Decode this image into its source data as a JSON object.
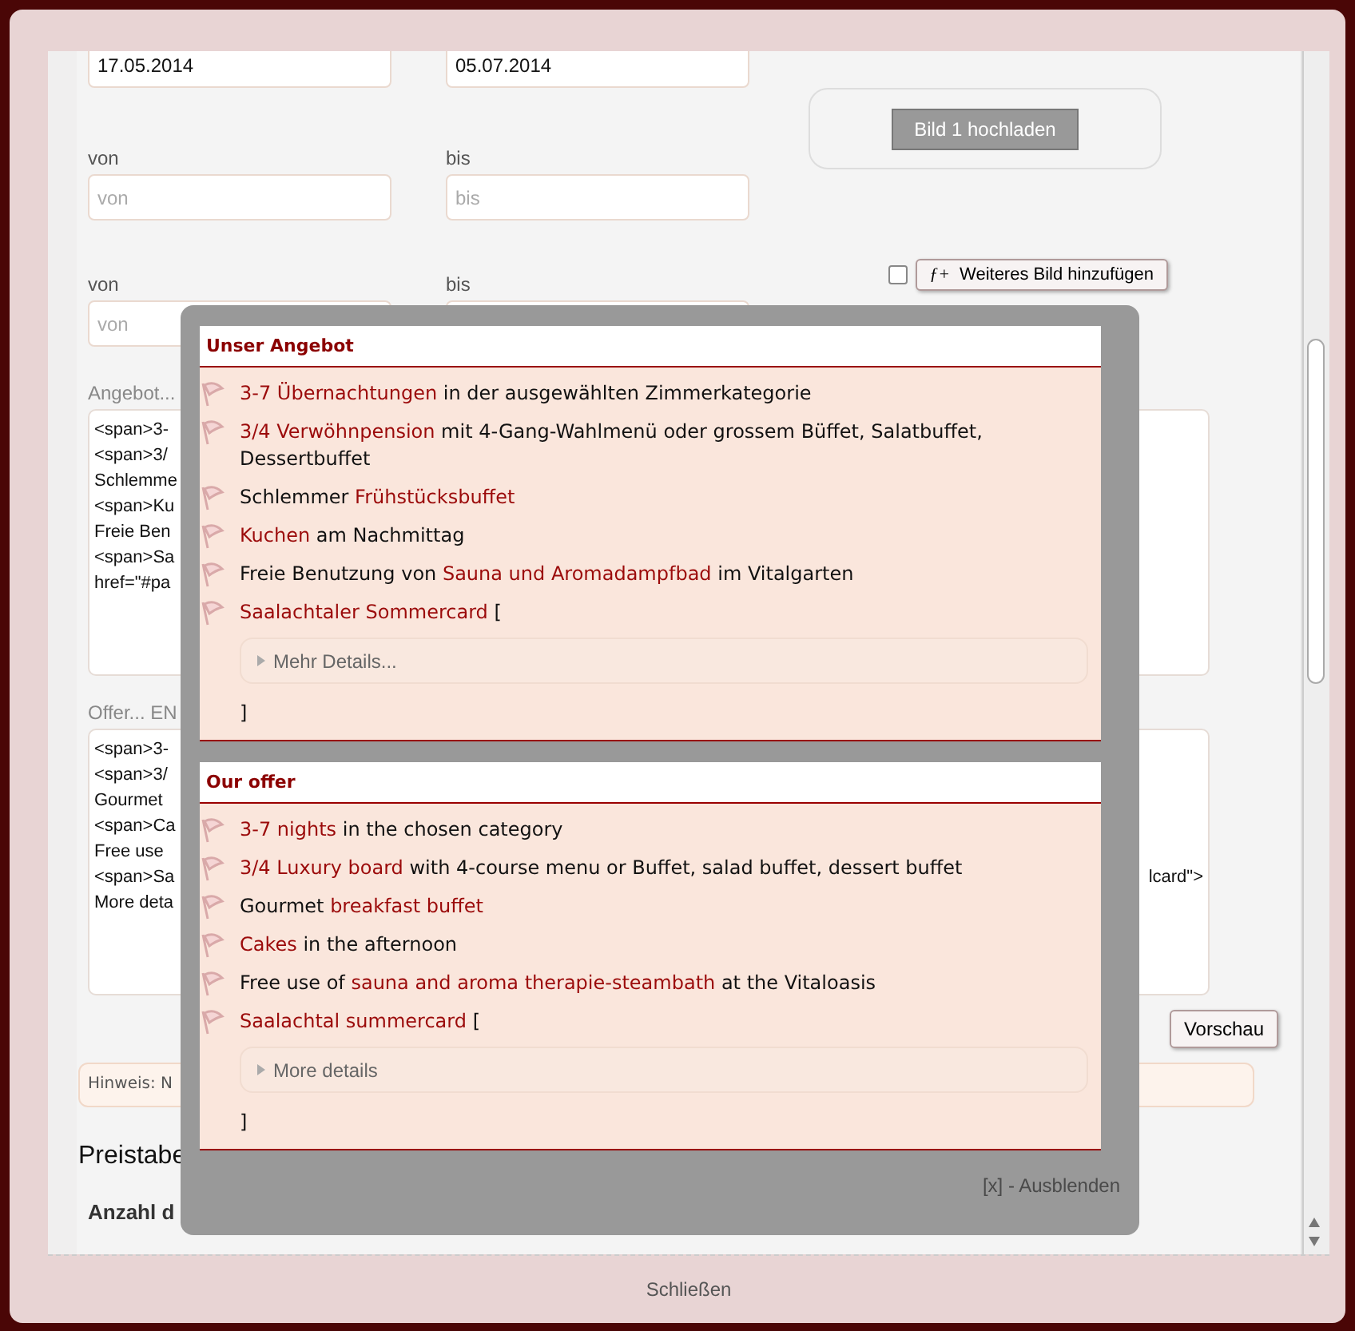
{
  "form": {
    "date_fields": [
      {
        "value": "17.05.2014"
      },
      {
        "value": "05.07.2014"
      }
    ],
    "range_rows": [
      {
        "from_label": "von",
        "from_placeholder": "von",
        "to_label": "bis",
        "to_placeholder": "bis"
      },
      {
        "from_label": "von",
        "from_placeholder": "von",
        "to_label": "bis"
      }
    ],
    "upload_button": "Bild 1 hochladen",
    "add_image": {
      "checked": false,
      "icon": "ƒ+",
      "label": "Weiteres Bild hinzufügen"
    },
    "text_areas": [
      {
        "label": "Angebot...",
        "lines": [
          "<span>3-",
          "<span>3/",
          "Schlemme",
          "<span>Ku",
          "Freie Ben",
          "<span>Sa",
          "href=\"#pa"
        ]
      },
      {
        "label": "Offer... EN",
        "lines": [
          "<span>3-",
          "<span>3/",
          "Gourmet",
          "<span>Ca",
          "Free use",
          "<span>Sa",
          "More deta"
        ],
        "right_fragment": "lcard\">"
      }
    ],
    "preview_button": "Vorschau",
    "hint": "Hinweis: N",
    "heading": "Preistabe",
    "subheading": "Anzahl d"
  },
  "popup": {
    "sections": [
      {
        "title": "Unser Angebot",
        "items": [
          {
            "segments": [
              {
                "text": "3-7 Übernachtungen",
                "highlight": true
              },
              {
                "text": " in der ausgewählten Zimmerkategorie",
                "highlight": false
              }
            ]
          },
          {
            "segments": [
              {
                "text": "3/4 Verwöhnpension",
                "highlight": true
              },
              {
                "text": " mit 4-Gang-Wahlmenü oder grossem Büffet, Salatbuffet, Dessertbuffet",
                "highlight": false
              }
            ]
          },
          {
            "segments": [
              {
                "text": "Schlemmer ",
                "highlight": false
              },
              {
                "text": "Frühstücksbuffet",
                "highlight": true
              }
            ]
          },
          {
            "segments": [
              {
                "text": "Kuchen",
                "highlight": true
              },
              {
                "text": " am Nachmittag",
                "highlight": false
              }
            ]
          },
          {
            "segments": [
              {
                "text": "Freie Benutzung von ",
                "highlight": false
              },
              {
                "text": "Sauna und Aromadampfbad",
                "highlight": true
              },
              {
                "text": " im Vitalgarten",
                "highlight": false
              }
            ]
          },
          {
            "segments": [
              {
                "text": "Saalachtaler Sommercard",
                "highlight": true
              },
              {
                "text": " [",
                "highlight": false
              }
            ]
          }
        ],
        "details": "Mehr Details...",
        "closing": "]"
      },
      {
        "title": "Our offer",
        "items": [
          {
            "segments": [
              {
                "text": "3-7 nights",
                "highlight": true
              },
              {
                "text": " in the chosen category",
                "highlight": false
              }
            ]
          },
          {
            "segments": [
              {
                "text": "3/4 Luxury board",
                "highlight": true
              },
              {
                "text": " with 4-course menu or Buffet, salad buffet, dessert buffet",
                "highlight": false
              }
            ]
          },
          {
            "segments": [
              {
                "text": "Gourmet ",
                "highlight": false
              },
              {
                "text": "breakfast buffet",
                "highlight": true
              }
            ]
          },
          {
            "segments": [
              {
                "text": "Cakes",
                "highlight": true
              },
              {
                "text": " in the afternoon",
                "highlight": false
              }
            ]
          },
          {
            "segments": [
              {
                "text": "Free use of ",
                "highlight": false
              },
              {
                "text": "sauna and aroma therapie-steambath",
                "highlight": true
              },
              {
                "text": " at the Vitaloasis",
                "highlight": false
              }
            ]
          },
          {
            "segments": [
              {
                "text": "Saalachtal summercard",
                "highlight": true
              },
              {
                "text": " [",
                "highlight": false
              }
            ]
          }
        ],
        "details": "More details",
        "closing": "]"
      }
    ],
    "hide_link": "[x] - Ausblenden"
  },
  "close_button": "Schließen"
}
